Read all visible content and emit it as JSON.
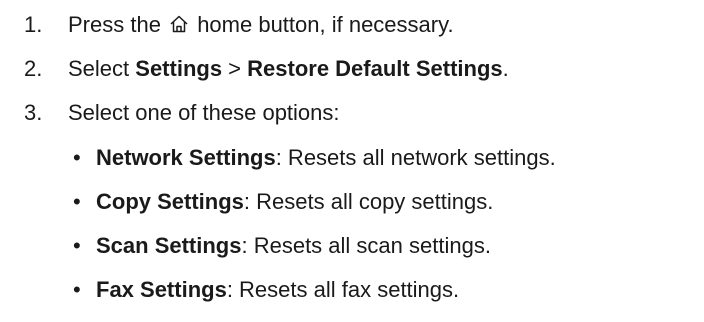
{
  "steps": [
    {
      "number": "1.",
      "before": "Press the",
      "icon": "home-icon",
      "after": "home button, if necessary."
    },
    {
      "number": "2.",
      "prefix": "Select ",
      "bold1": "Settings",
      "sep": " > ",
      "bold2": "Restore Default Settings",
      "suffix": "."
    },
    {
      "number": "3.",
      "text": "Select one of these options:"
    }
  ],
  "options": [
    {
      "bullet": "•",
      "name": "Network Settings",
      "desc": ": Resets all network settings."
    },
    {
      "bullet": "•",
      "name": "Copy Settings",
      "desc": ": Resets all copy settings."
    },
    {
      "bullet": "•",
      "name": "Scan Settings",
      "desc": ": Resets all scan settings."
    },
    {
      "bullet": "•",
      "name": "Fax Settings",
      "desc": ": Resets all fax settings."
    }
  ]
}
